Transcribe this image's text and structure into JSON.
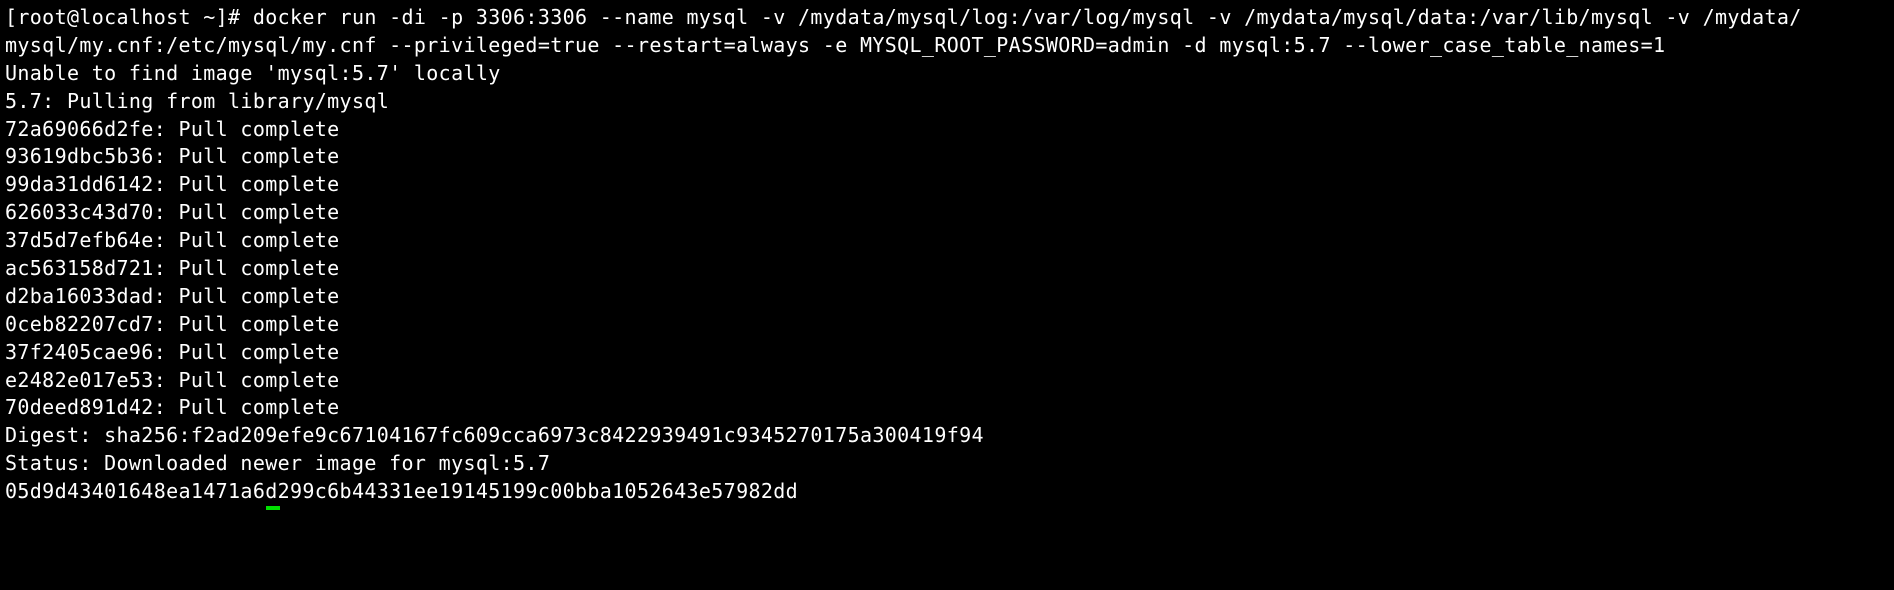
{
  "terminal": {
    "lines": [
      "[root@localhost ~]# docker run -di -p 3306:3306 --name mysql -v /mydata/mysql/log:/var/log/mysql -v /mydata/mysql/data:/var/lib/mysql -v /mydata/",
      "mysql/my.cnf:/etc/mysql/my.cnf --privileged=true --restart=always -e MYSQL_ROOT_PASSWORD=admin -d mysql:5.7 --lower_case_table_names=1",
      "Unable to find image 'mysql:5.7' locally",
      "5.7: Pulling from library/mysql",
      "72a69066d2fe: Pull complete",
      "93619dbc5b36: Pull complete",
      "99da31dd6142: Pull complete",
      "626033c43d70: Pull complete",
      "37d5d7efb64e: Pull complete",
      "ac563158d721: Pull complete",
      "d2ba16033dad: Pull complete",
      "0ceb82207cd7: Pull complete",
      "37f2405cae96: Pull complete",
      "e2482e017e53: Pull complete",
      "70deed891d42: Pull complete",
      "Digest: sha256:f2ad209efe9c67104167fc609cca6973c8422939491c9345270175a300419f94",
      "Status: Downloaded newer image for mysql:5.7",
      "05d9d43401648ea1471a6d299c6b44331ee19145199c00bba1052643e57982dd"
    ]
  },
  "colors": {
    "background": "#000000",
    "foreground": "#ffffff",
    "cursor": "#00e000"
  }
}
